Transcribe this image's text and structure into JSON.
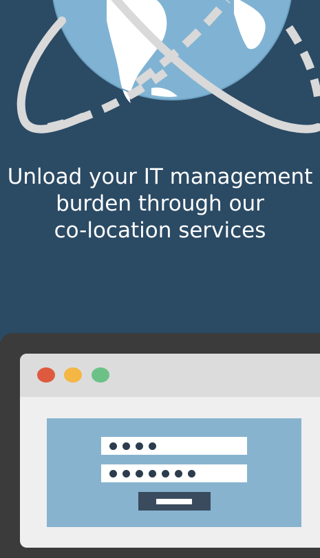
{
  "hero": {
    "headline_lines": [
      "Unload your IT management",
      "burden through our",
      "co-location services"
    ],
    "illustration_icon": "globe-with-orbit-icon"
  },
  "login_illustration": {
    "window_controls": [
      "close-dot-icon",
      "minimize-dot-icon",
      "maximize-dot-icon"
    ],
    "username_mask_count": 4,
    "password_mask_count": 7
  },
  "colors": {
    "background": "#2b4a64",
    "globe_ocean": "#7fb1d1",
    "orbit": "#d9d9d9",
    "laptop_frame": "#3b3b3b",
    "window_red": "#de5a3e",
    "window_yellow": "#f5b644",
    "window_green": "#6cc186",
    "login_panel": "#87b3cf",
    "button": "#3a4b5e"
  }
}
